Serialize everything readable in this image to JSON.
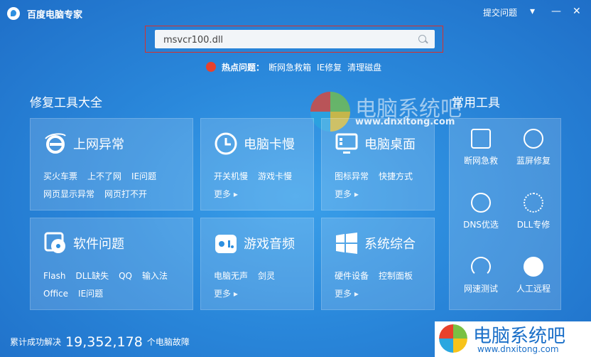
{
  "app": {
    "title": "百度电脑专家",
    "feedback": "提交问题"
  },
  "window_controls": [
    "▾",
    "—",
    "✕"
  ],
  "search": {
    "value": "msvcr100.dll"
  },
  "hot": {
    "label": "热点问题：",
    "links": [
      "断网急救箱",
      "IE修复",
      "清理磁盘"
    ]
  },
  "sections": {
    "repair": "修复工具大全",
    "tools": "常用工具"
  },
  "cards": [
    {
      "title": "上网异常",
      "icon": "ie-icon",
      "rows": [
        [
          "买火车票",
          "上不了网",
          "IE问题"
        ],
        [
          "网页显示异常",
          "网页打不开"
        ]
      ]
    },
    {
      "title": "电脑卡慢",
      "icon": "clock-icon",
      "rows": [
        [
          "开关机慢",
          "游戏卡慢"
        ],
        [
          "更多 ▸"
        ]
      ]
    },
    {
      "title": "电脑桌面",
      "icon": "monitor-icon",
      "rows": [
        [
          "图标异常",
          "快捷方式"
        ],
        [
          "更多 ▸"
        ]
      ]
    },
    {
      "title": "软件问题",
      "icon": "software-icon",
      "rows": [
        [
          "Flash",
          "DLL缺失",
          "QQ",
          "输入法"
        ],
        [
          "Office",
          "IE问题"
        ]
      ]
    },
    {
      "title": "游戏音频",
      "icon": "gamepad-icon",
      "rows": [
        [
          "电脑无声",
          "剑灵"
        ],
        [
          "更多 ▸"
        ]
      ]
    },
    {
      "title": "系统综合",
      "icon": "windows-icon",
      "rows": [
        [
          "硬件设备",
          "控制面板"
        ],
        [
          "更多 ▸"
        ]
      ]
    }
  ],
  "tools": [
    {
      "label": "断网急救",
      "icon": "network-rescue-icon"
    },
    {
      "label": "蓝屏修复",
      "icon": "bluescreen-repair-icon"
    },
    {
      "label": "DNS优选",
      "icon": "dns-icon"
    },
    {
      "label": "DLL专修",
      "icon": "gears-icon"
    },
    {
      "label": "网速测试",
      "icon": "speedometer-icon"
    },
    {
      "label": "人工远程",
      "icon": "support-agent-icon"
    }
  ],
  "footer": {
    "prefix": "累计成功解决",
    "count": "19,352,178",
    "suffix": "个电脑故障"
  },
  "watermark": {
    "title": "电脑系统吧",
    "url": "www.dnxitong.com"
  },
  "colors": {
    "background": "#2a88db",
    "accent_red": "#d9302a",
    "watermark_blue": "#1a6fc8"
  }
}
